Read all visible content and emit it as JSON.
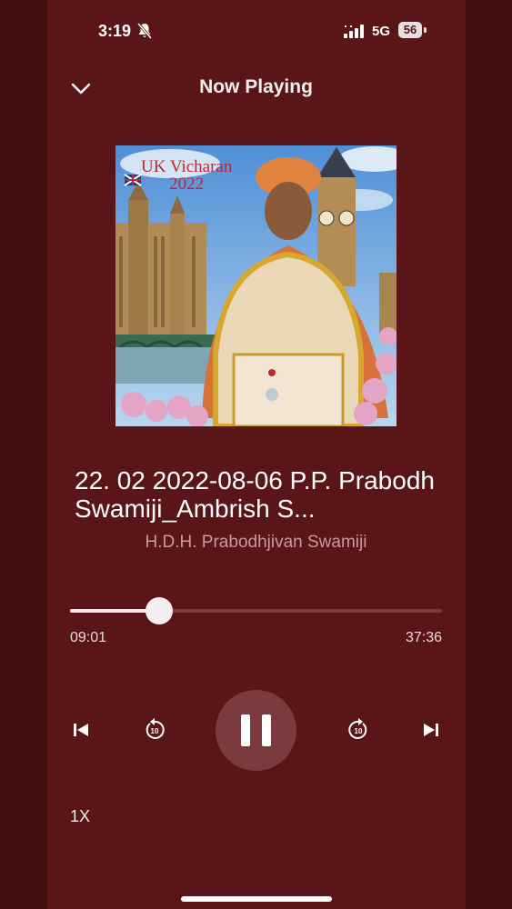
{
  "status_bar": {
    "time": "3:19",
    "network": "5G",
    "battery": "56",
    "icons": [
      "bell-slash-icon",
      "signal-icon"
    ]
  },
  "header": {
    "title": "Now Playing",
    "collapse_icon": "chevron-down-icon"
  },
  "artwork": {
    "caption_line1": "UK Vicharan",
    "caption_line2": "2022"
  },
  "track": {
    "title": "22. 02 2022-08-06 P.P. Prabodh Swamiji_Ambrish S...",
    "artist": "H.D.H. Prabodhjivan Swamiji"
  },
  "playback": {
    "elapsed": "09:01",
    "duration": "37:36",
    "progress_fraction": 0.24,
    "state": "playing",
    "speed": "1X",
    "skip_seconds": "10"
  },
  "colors": {
    "background": "#591518",
    "accent": "#f7efef",
    "secondary_text": "#c79a9d"
  }
}
